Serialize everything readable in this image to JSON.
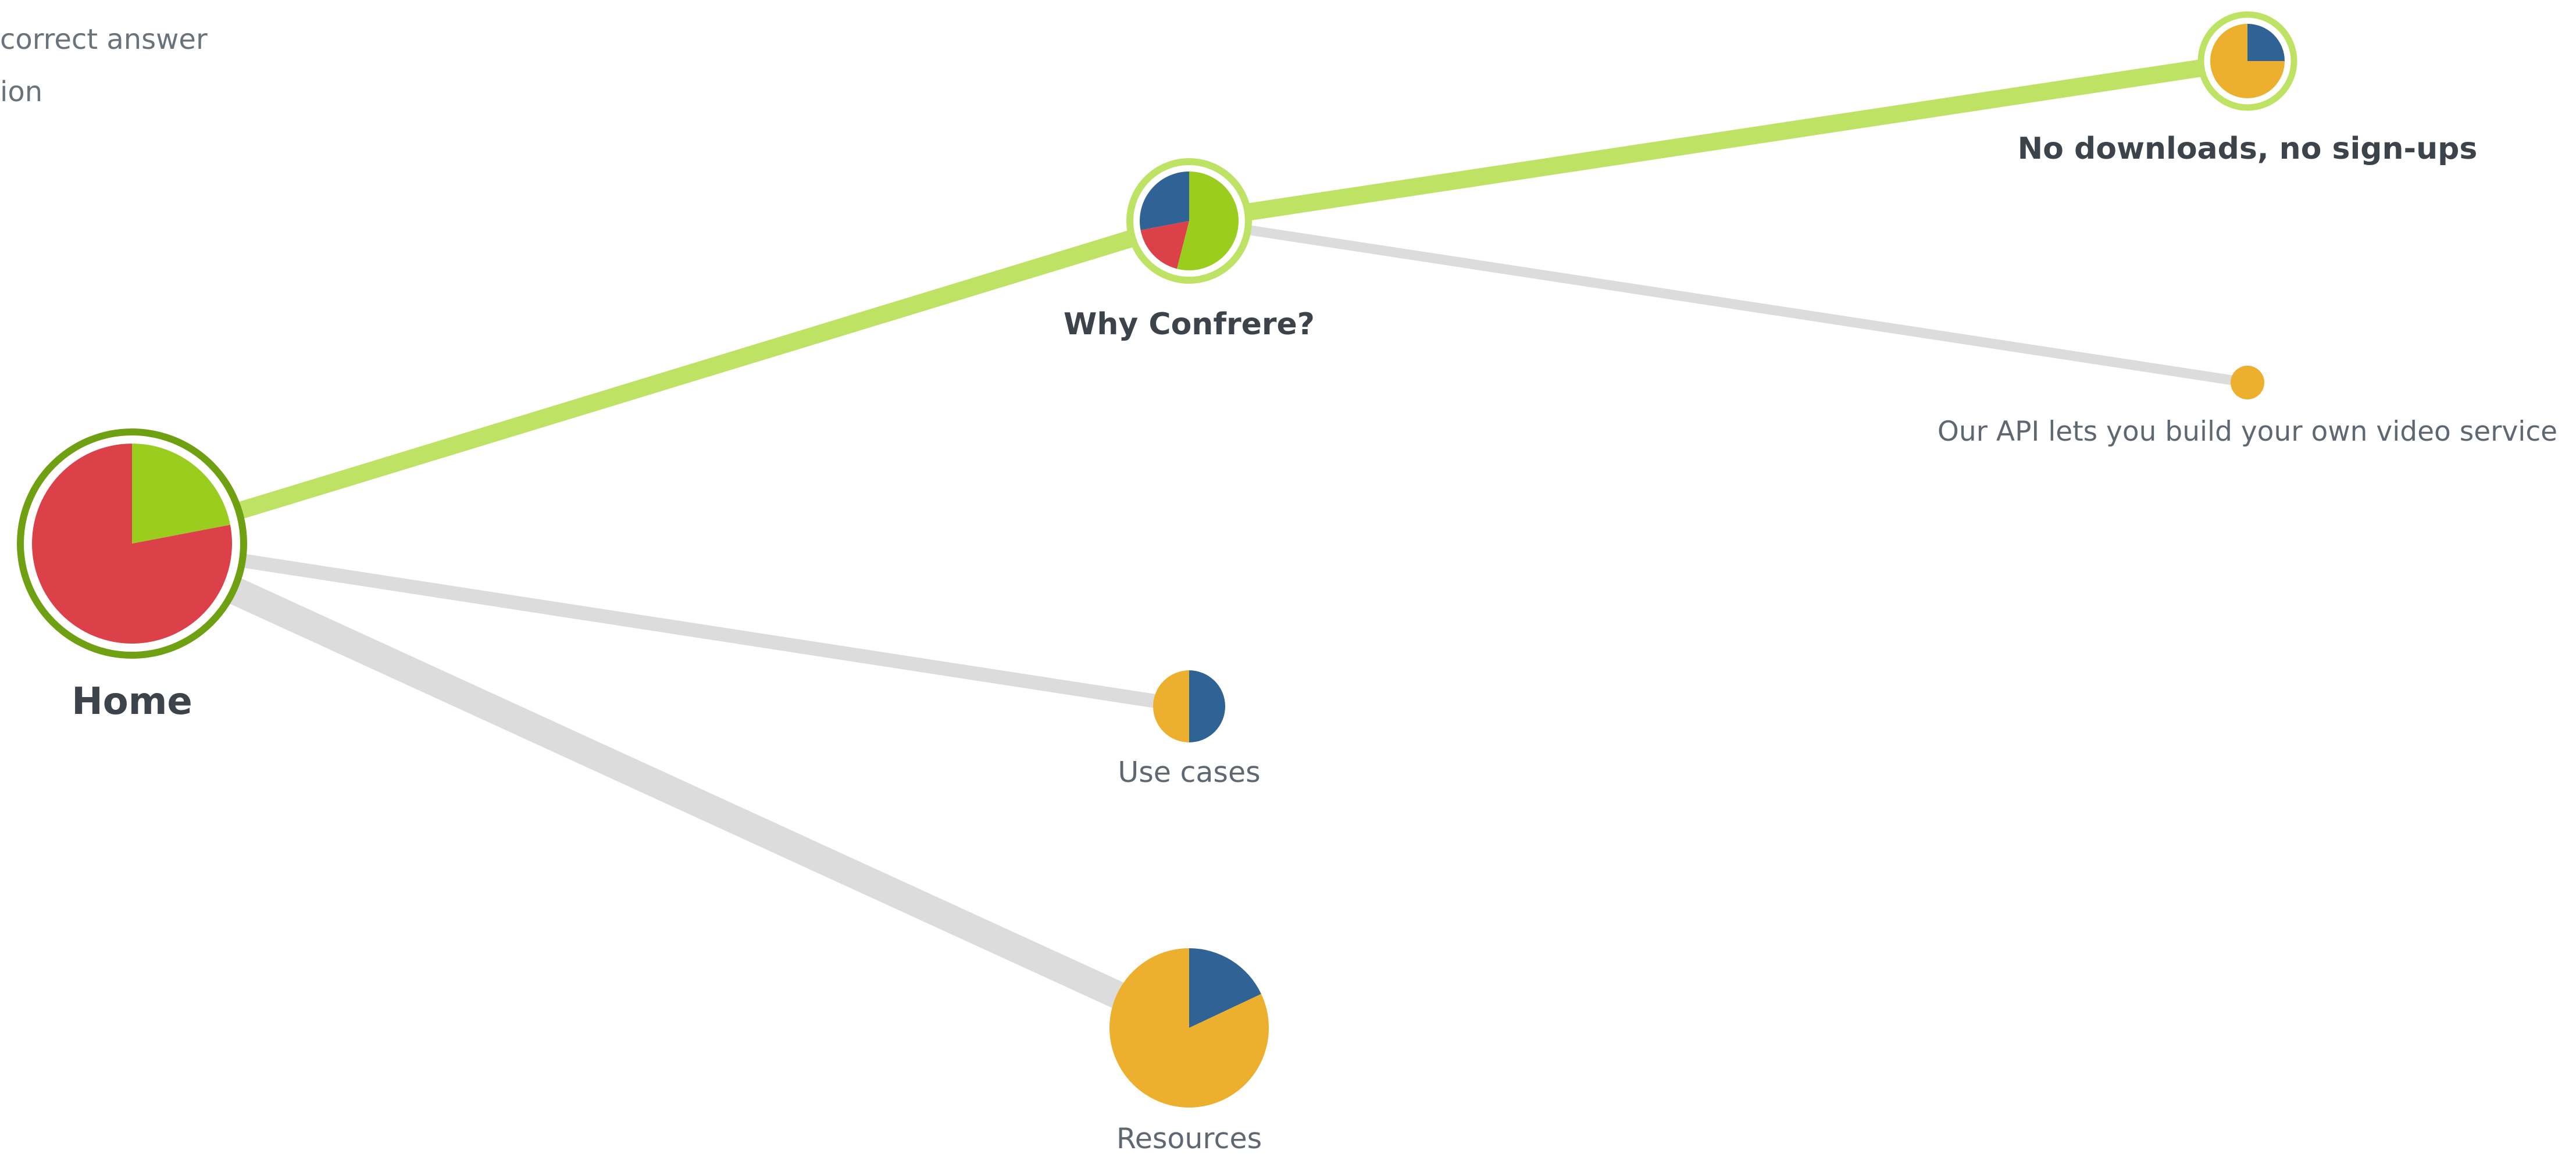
{
  "legend": {
    "line1": "correct answer",
    "line2": "ion"
  },
  "colors": {
    "green": "#9bcd1e",
    "green_edge": "#bde264",
    "green_ring": "#6fa011",
    "red": "#dc414a",
    "blue": "#2f6295",
    "orange": "#ecb02e",
    "gray_edge": "#dcdcdc",
    "label": "#3d434a",
    "label_light": "#5f6872"
  },
  "nodes": [
    {
      "id": "home",
      "label": "Home",
      "emphasis": "bold",
      "ring": "solid-green",
      "slices": [
        {
          "color": "green",
          "fraction": 0.22
        },
        {
          "color": "red",
          "fraction": 0.78
        }
      ]
    },
    {
      "id": "why",
      "label": "Why Confrere?",
      "emphasis": "bold",
      "ring": "light-green",
      "slices": [
        {
          "color": "green",
          "fraction": 0.54
        },
        {
          "color": "red",
          "fraction": 0.18
        },
        {
          "color": "blue",
          "fraction": 0.28
        }
      ]
    },
    {
      "id": "use",
      "label": "Use cases",
      "emphasis": "normal",
      "ring": "none",
      "slices": [
        {
          "color": "blue",
          "fraction": 0.5
        },
        {
          "color": "orange",
          "fraction": 0.5
        }
      ]
    },
    {
      "id": "resources",
      "label": "Resources",
      "emphasis": "normal",
      "ring": "none",
      "slices": [
        {
          "color": "blue",
          "fraction": 0.18
        },
        {
          "color": "orange",
          "fraction": 0.82
        }
      ]
    },
    {
      "id": "nodl",
      "label": "No downloads, no sign-ups",
      "emphasis": "bold",
      "ring": "light-green",
      "slices": [
        {
          "color": "blue",
          "fraction": 0.25
        },
        {
          "color": "orange",
          "fraction": 0.75
        }
      ]
    },
    {
      "id": "api",
      "label": "Our API lets you build your own video service",
      "emphasis": "normal",
      "ring": "none",
      "slices": [
        {
          "color": "orange",
          "fraction": 1.0
        }
      ]
    }
  ],
  "edges": [
    {
      "from": "home",
      "to": "why",
      "style": "green"
    },
    {
      "from": "home",
      "to": "use",
      "style": "gray"
    },
    {
      "from": "home",
      "to": "resources",
      "style": "gray"
    },
    {
      "from": "why",
      "to": "nodl",
      "style": "green"
    },
    {
      "from": "why",
      "to": "api",
      "style": "gray"
    }
  ]
}
